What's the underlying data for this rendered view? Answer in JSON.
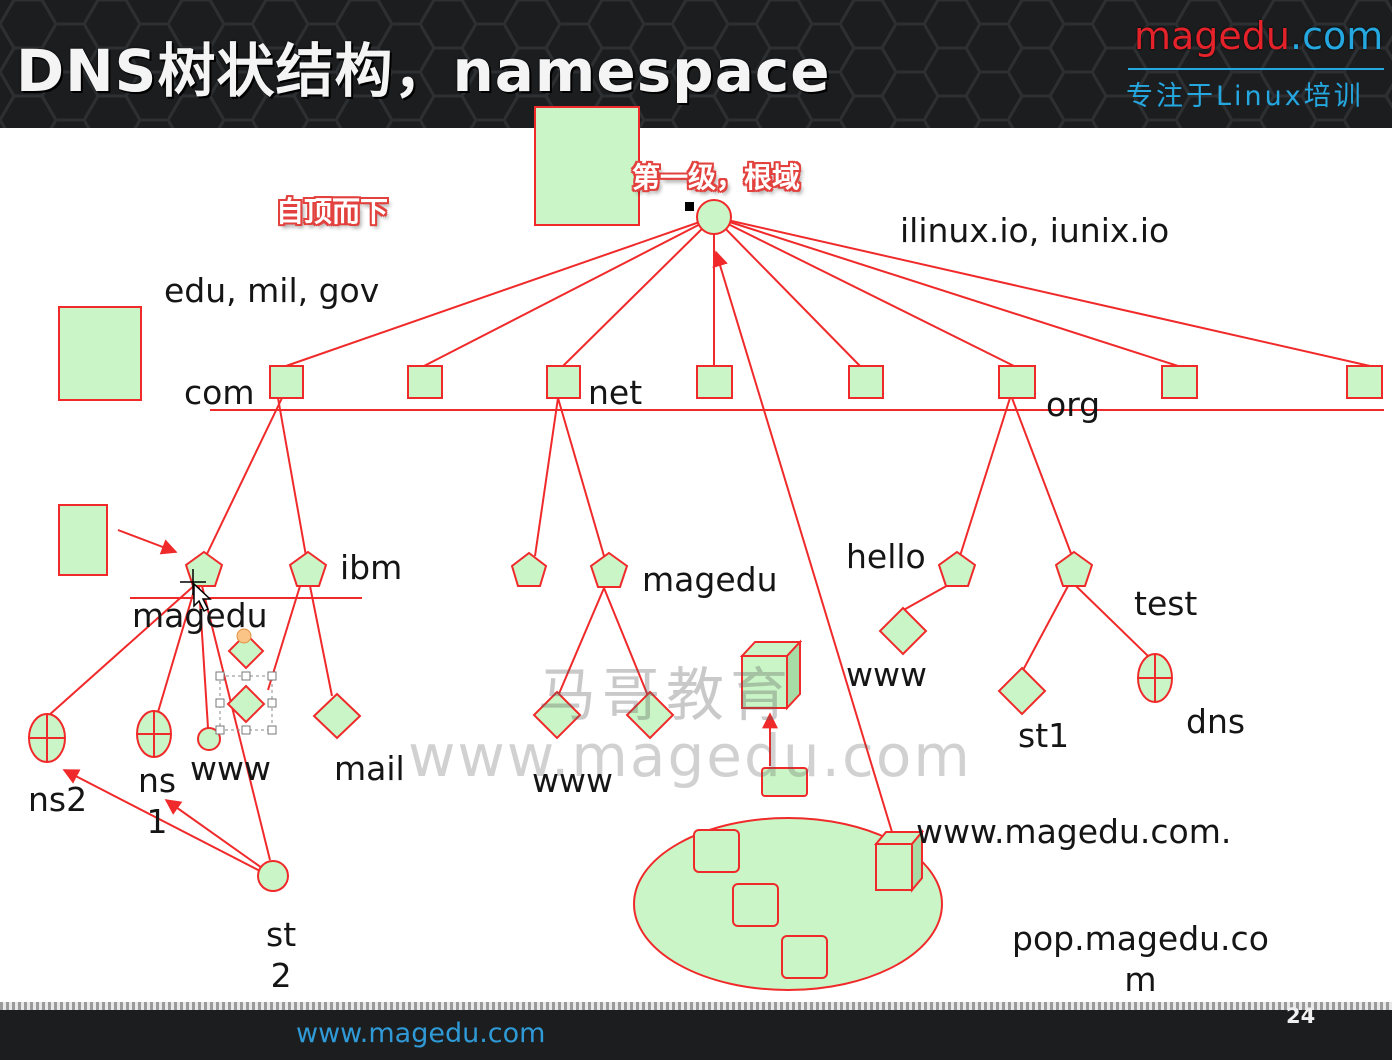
{
  "header": {
    "title": "DNS树状结构，namespace",
    "brand_red": "magedu",
    "brand_blue": ".com",
    "slogan": "专注于Linux培训"
  },
  "footer": {
    "url": "www.magedu.com",
    "page_number": "24"
  },
  "annotations": {
    "top_down": "自顶而下",
    "root_level": "第一级，根域"
  },
  "labels": {
    "ilinux": "ilinux.io, iunix.io",
    "edu": "edu, mil, gov",
    "com": "com",
    "net": "net",
    "org": "org",
    "ibm": "ibm",
    "magedu_com": "magedu",
    "magedu_net": "magedu",
    "hello": "hello",
    "test": "test",
    "www_hello": "www",
    "st1": "st1",
    "dns": "dns",
    "ns2": "ns2",
    "ns1": "ns\n1",
    "www_com": "www",
    "mail": "mail",
    "www_net": "www",
    "st2": "st\n2",
    "www_fqdn": "www.magedu.com.",
    "pop": "pop.magedu.co\nm"
  },
  "watermark": {
    "cn": "马哥教育",
    "url": "www.magedu.com"
  },
  "colors": {
    "stroke": "#f02a2a",
    "fill": "#c9f5c7",
    "header_bg": "#1b1d1f",
    "brand_red": "#e4222a",
    "brand_blue": "#25a7e0"
  }
}
